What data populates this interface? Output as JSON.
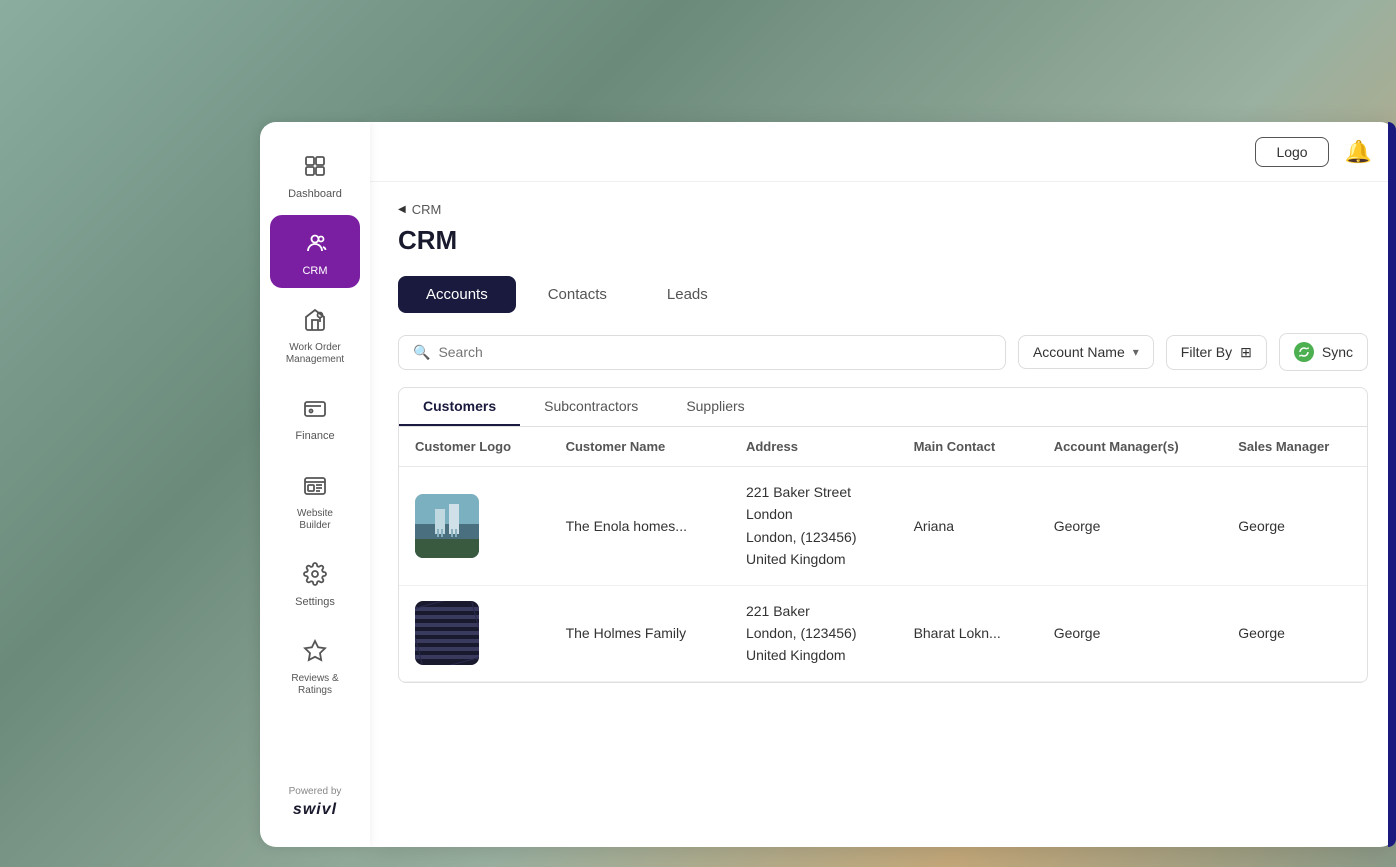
{
  "header": {
    "logo_label": "Logo",
    "bell_icon": "bell"
  },
  "breadcrumb": {
    "parent": "CRM",
    "current": "CRM"
  },
  "page_title": "CRM",
  "tabs": [
    {
      "id": "accounts",
      "label": "Accounts",
      "active": true
    },
    {
      "id": "contacts",
      "label": "Contacts",
      "active": false
    },
    {
      "id": "leads",
      "label": "Leads",
      "active": false
    }
  ],
  "search": {
    "placeholder": "Search",
    "dropdown_label": "Account Name",
    "filter_label": "Filter By",
    "sync_label": "Sync"
  },
  "sub_tabs": [
    {
      "id": "customers",
      "label": "Customers",
      "active": true
    },
    {
      "id": "subcontractors",
      "label": "Subcontractors",
      "active": false
    },
    {
      "id": "suppliers",
      "label": "Suppliers",
      "active": false
    }
  ],
  "table": {
    "columns": [
      "Customer Logo",
      "Customer Name",
      "Address",
      "Main Contact",
      "Account Manager(s)",
      "Sales Manager"
    ],
    "rows": [
      {
        "logo_type": "building1",
        "customer_name": "The Enola homes...",
        "address_line1": "221 Baker Street",
        "address_line2": "London",
        "address_line3": "London, (123456)",
        "address_line4": "United Kingdom",
        "main_contact": "Ariana",
        "account_manager": "George",
        "sales_manager": "George"
      },
      {
        "logo_type": "building2",
        "customer_name": "The Holmes Family",
        "address_line1": "221 Baker",
        "address_line2": "London, (123456)",
        "address_line3": "United Kingdom",
        "address_line4": "",
        "main_contact": "Bharat Lokn...",
        "account_manager": "George",
        "sales_manager": "George"
      }
    ]
  },
  "sidebar": {
    "items": [
      {
        "id": "dashboard",
        "label": "Dashboard",
        "icon": "⊞",
        "active": false
      },
      {
        "id": "crm",
        "label": "CRM",
        "icon": "👤",
        "active": true
      },
      {
        "id": "work-order",
        "label": "Work Order Management",
        "icon": "🏠",
        "active": false
      },
      {
        "id": "finance",
        "label": "Finance",
        "icon": "💳",
        "active": false
      },
      {
        "id": "website-builder",
        "label": "Website Builder",
        "icon": "🖥",
        "active": false
      },
      {
        "id": "settings",
        "label": "Settings",
        "icon": "⚙",
        "active": false
      },
      {
        "id": "reviews",
        "label": "Reviews & Ratings",
        "icon": "☆",
        "active": false
      }
    ],
    "powered_by": "Powered by",
    "brand_name": "swivl"
  }
}
